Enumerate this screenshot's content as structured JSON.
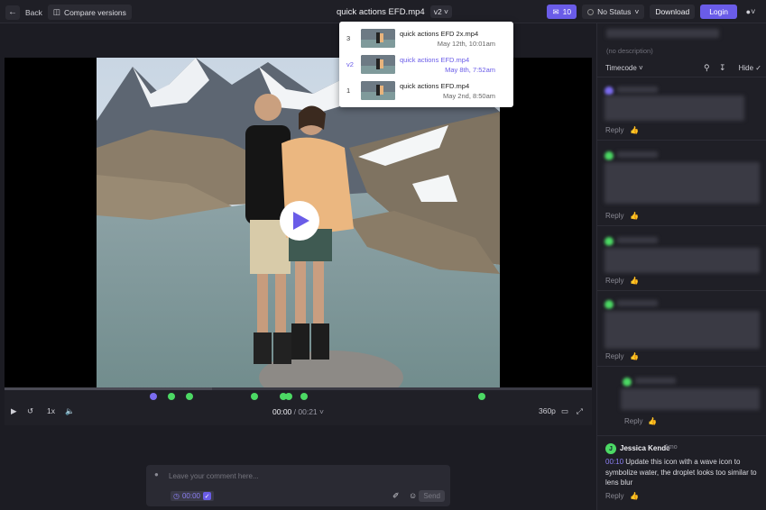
{
  "topbar": {
    "back_label": "Back",
    "compare_label": "Compare versions",
    "file_name": "quick actions EFD.mp4",
    "version": "v2",
    "comment_count": "10",
    "status": "No Status",
    "download_label": "Download",
    "login_label": "Login"
  },
  "versions": [
    {
      "num": "3",
      "name": "quick actions EFD 2x.mp4",
      "date": "May 12th, 10:01am"
    },
    {
      "num": "v2",
      "name": "quick actions EFD.mp4",
      "date": "May 8th, 7:52am"
    },
    {
      "num": "1",
      "name": "quick actions EFD.mp4",
      "date": "May 2nd, 8:50am"
    }
  ],
  "player": {
    "speed": "1x",
    "current_time": "00:00",
    "duration": "/ 00:21",
    "quality": "360p"
  },
  "composer": {
    "placeholder": "Leave your comment here...",
    "timecode": "00:00",
    "send_label": "Send"
  },
  "panel": {
    "description": "(no description)",
    "sort_label": "Timecode",
    "hide_label": "Hide",
    "reply_label": "Reply",
    "last_comment": {
      "author": "Jessica Kende",
      "initial": "J",
      "age": "1mo",
      "timestamp": "00:10",
      "text": "Update this icon with a wave icon to symbolize water, the droplet looks too similar to lens blur"
    }
  },
  "colors": {
    "accent": "#6a5ce8",
    "marker_green": "#4cd964"
  }
}
